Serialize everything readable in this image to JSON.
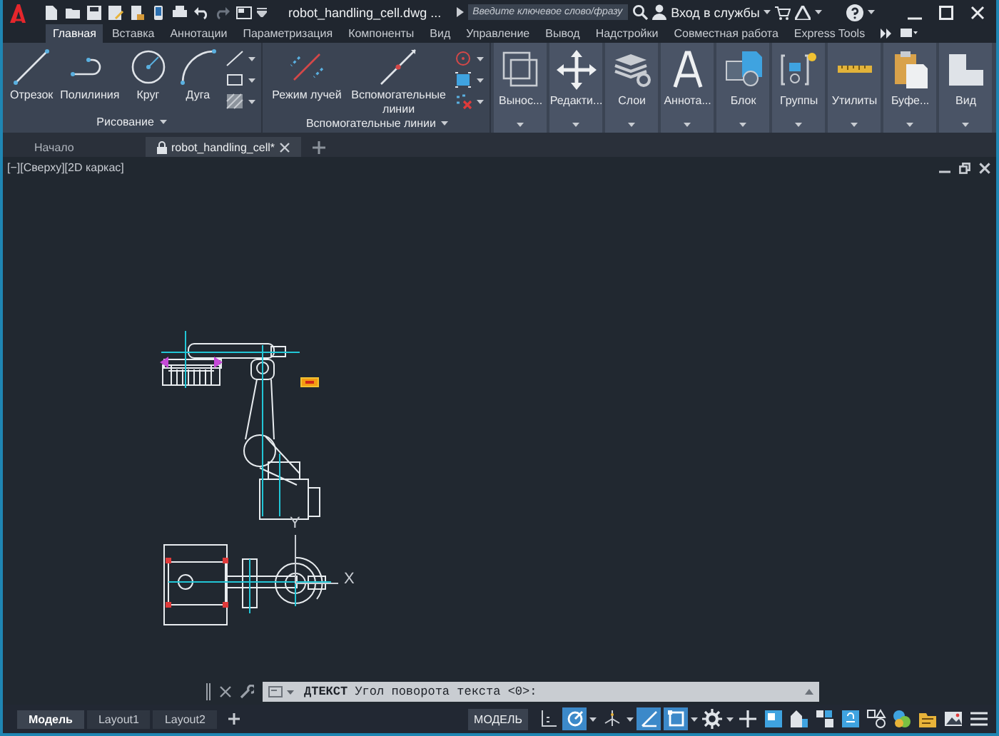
{
  "title_bar": {
    "file_name": "robot_handling_cell.dwg ...",
    "search": {
      "placeholder": "Введите ключевое слово/фразу"
    },
    "sign_in": "Вход в службы"
  },
  "ribbon_tabs": [
    {
      "label": "Главная",
      "selected": true
    },
    {
      "label": "Вставка",
      "selected": false
    },
    {
      "label": "Аннотации",
      "selected": false
    },
    {
      "label": "Параметризация",
      "selected": false
    },
    {
      "label": "Компоненты",
      "selected": false
    },
    {
      "label": "Вид",
      "selected": false
    },
    {
      "label": "Управление",
      "selected": false
    },
    {
      "label": "Вывод",
      "selected": false
    },
    {
      "label": "Надстройки",
      "selected": false
    },
    {
      "label": "Совместная работа",
      "selected": false
    },
    {
      "label": "Express Tools",
      "selected": false
    }
  ],
  "ribbon": {
    "draw_panel": {
      "title": "Рисование",
      "tools": [
        {
          "label": "Отрезок",
          "kind": "line"
        },
        {
          "label": "Полилиния",
          "kind": "polyline"
        },
        {
          "label": "Круг",
          "kind": "circle"
        },
        {
          "label": "Дуга",
          "kind": "arc"
        }
      ]
    },
    "guides_panel": {
      "title": "Вспомогательные линии",
      "tools": [
        {
          "label": "Режим лучей",
          "kind": "rays"
        },
        {
          "label": "Вспомогательные линии",
          "kind": "xline"
        }
      ]
    },
    "collapsed_panels": [
      {
        "label": "Вынос...",
        "kind": "leader"
      },
      {
        "label": "Редакти...",
        "kind": "move"
      },
      {
        "label": "Слои",
        "kind": "layers"
      },
      {
        "label": "Аннота...",
        "kind": "text"
      },
      {
        "label": "Блок",
        "kind": "block"
      },
      {
        "label": "Группы",
        "kind": "group"
      },
      {
        "label": "Утилиты",
        "kind": "measure"
      },
      {
        "label": "Буфе...",
        "kind": "clipboard"
      },
      {
        "label": "Вид",
        "kind": "view"
      }
    ]
  },
  "file_tabs": [
    {
      "label": "Начало",
      "selected": false,
      "locked": false
    },
    {
      "label": "robot_handling_cell*",
      "selected": true,
      "locked": true
    }
  ],
  "viewport": {
    "label": "[−][Сверху][2D каркас]",
    "ucs": {
      "y_label": "Y",
      "x_label": "X"
    }
  },
  "command_line": {
    "command": "ДТЕКСТ",
    "prompt": "Угол поворота текста <0>:"
  },
  "layout_tabs": [
    {
      "label": "Модель",
      "selected": true
    },
    {
      "label": "Layout1",
      "selected": false
    },
    {
      "label": "Layout2",
      "selected": false
    }
  ],
  "status_bar": {
    "space": "МОДЕЛЬ",
    "toggles": [
      {
        "kind": "grid",
        "on": false
      },
      {
        "kind": "polar",
        "on": true
      },
      {
        "kind": "isodraft",
        "on": false
      },
      {
        "kind": "otrack",
        "on": true
      },
      {
        "kind": "osnap",
        "on": true
      }
    ]
  }
}
